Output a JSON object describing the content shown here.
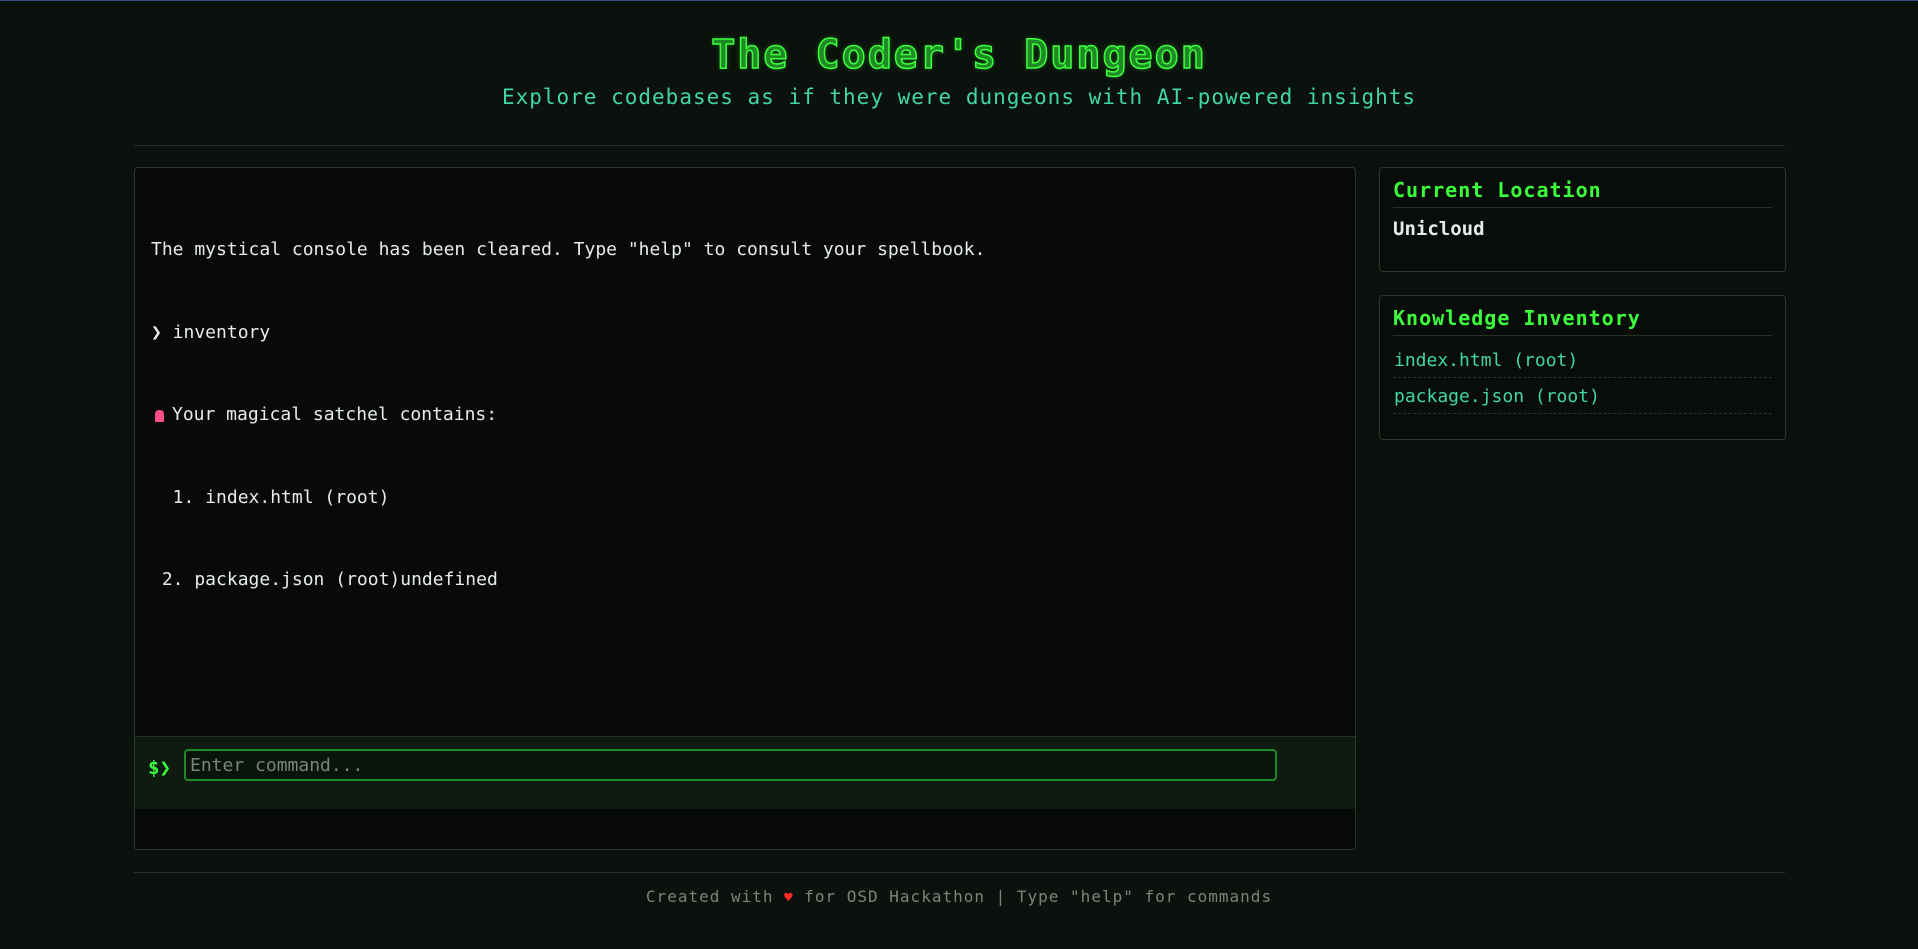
{
  "header": {
    "title": "The Coder's Dungeon",
    "subtitle": "Explore codebases as if they were dungeons with AI-powered insights"
  },
  "console": {
    "lines": {
      "cleared": "The mystical console has been cleared. Type \"help\" to consult your spellbook.",
      "command": "❯ inventory",
      "satchel": "Your magical satchel contains:",
      "item1": "  1. index.html (root)",
      "item2": " 2. package.json (root)undefined"
    },
    "prompt": "$❯",
    "input_value": "",
    "input_placeholder": "Enter command..."
  },
  "location_panel": {
    "heading": "Current Location",
    "value": "Unicloud"
  },
  "inventory_panel": {
    "heading": "Knowledge Inventory",
    "items": [
      "index.html (root)",
      "package.json (root)"
    ]
  },
  "footer": {
    "prefix": "Created with ",
    "heart": "♥",
    "suffix": " for OSD Hackathon | Type \"help\" for commands"
  },
  "colors": {
    "background": "#0b110d",
    "accent_green": "#3cff3c",
    "teal": "#41d6a4",
    "gem_pink": "#ff4f8b",
    "heart_red": "#ff2a2a"
  },
  "icons": {
    "satchel": "gem-icon",
    "heart": "heart-icon"
  }
}
